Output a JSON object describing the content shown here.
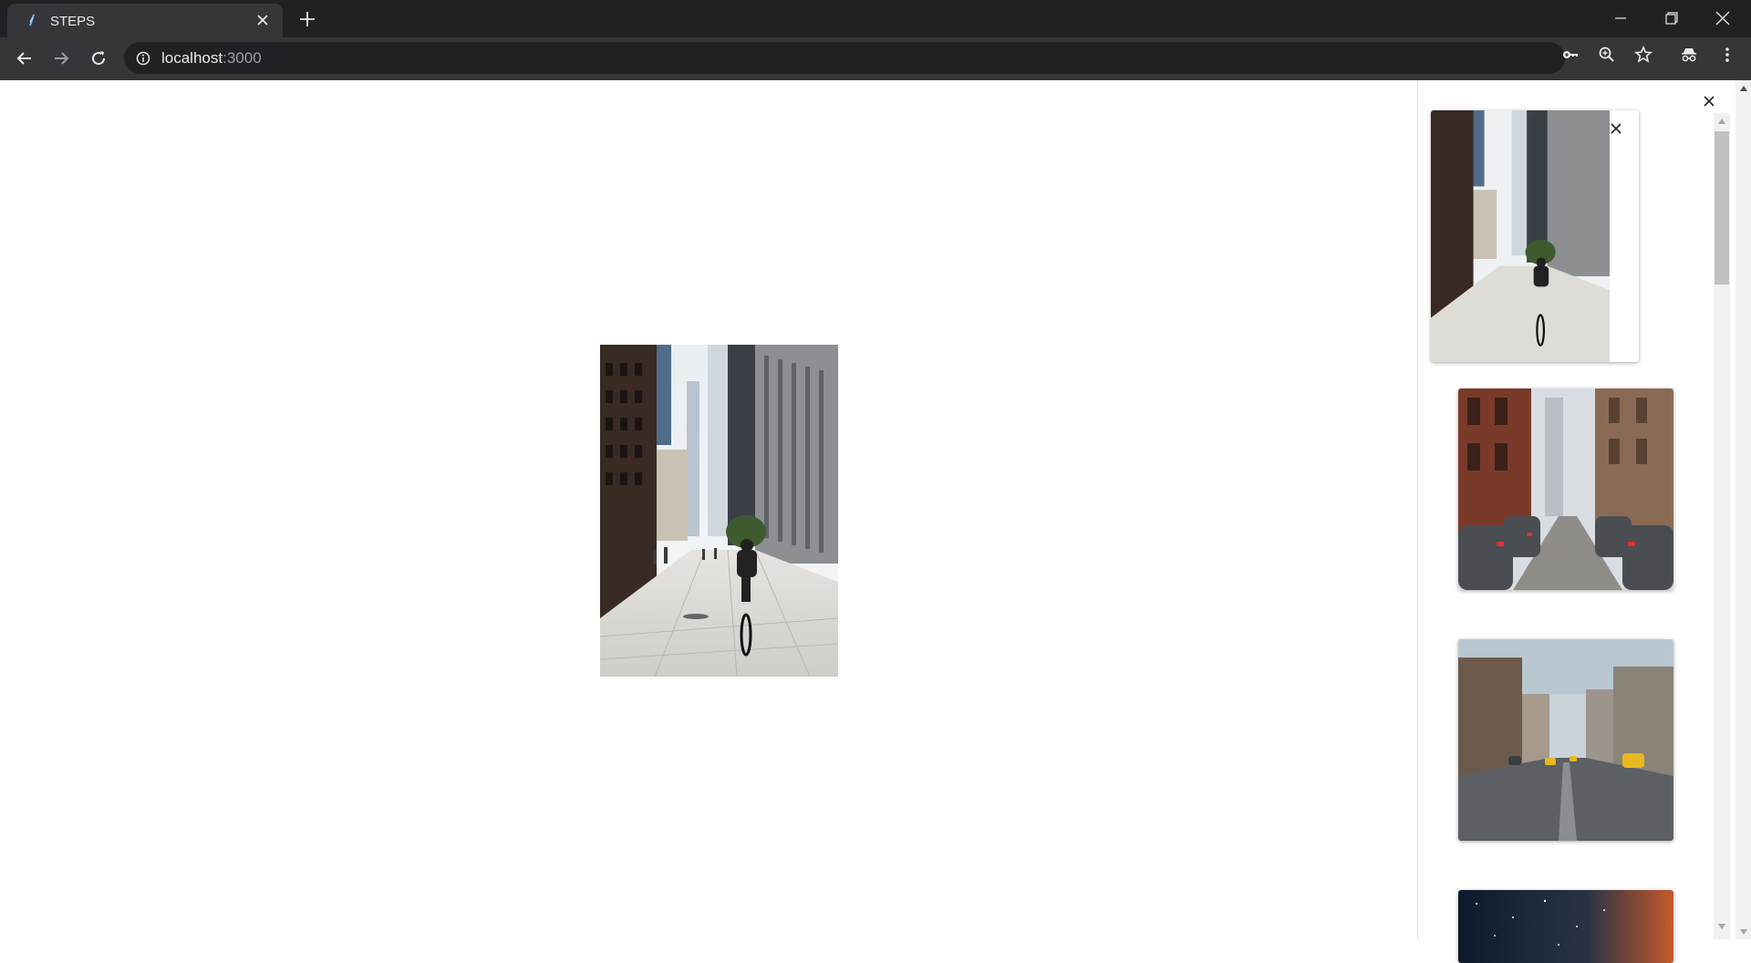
{
  "browser": {
    "tab_title": "STEPS",
    "url_host": "localhost",
    "url_port": ":3000",
    "colors": {
      "chrome_dark": "#202124",
      "chrome_mid": "#35363a",
      "text": "#e8eaed"
    }
  },
  "icons": {
    "tab_favicon": "steps-favicon-icon",
    "tab_close": "close-icon",
    "new_tab": "plus-icon",
    "back": "arrow-left-icon",
    "forward": "arrow-right-icon",
    "reload": "reload-icon",
    "site_info": "info-icon",
    "password": "key-icon",
    "zoom": "zoom-icon",
    "bookmark": "star-icon",
    "extensions": "incognito-icon",
    "menu": "kebab-menu-icon"
  },
  "gallery": {
    "main_image": "city street with cyclist",
    "thumbnails": [
      {
        "subject": "city street with cyclist",
        "selected": true
      },
      {
        "subject": "street lined with parked cars"
      },
      {
        "subject": "city avenue with yellow taxis"
      },
      {
        "subject": "starry night sky"
      }
    ]
  }
}
